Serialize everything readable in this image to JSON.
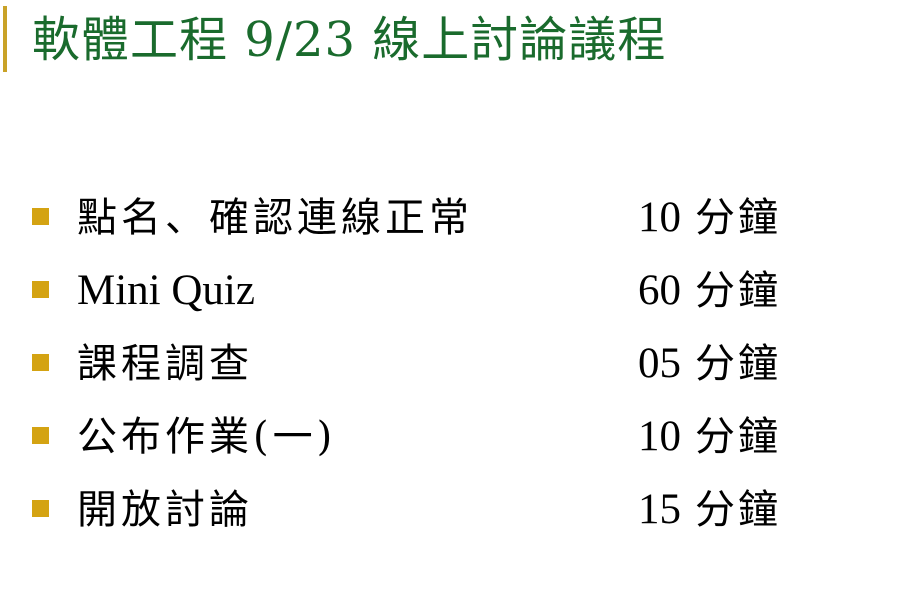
{
  "slide": {
    "title": "軟體工程 9/23 線上討論議程",
    "colors": {
      "title": "#1a6b2d",
      "accent_bar": "#c9a227",
      "bullet": "#d4a312"
    },
    "agenda": [
      {
        "topic": "點名、確認連線正常",
        "minutes": "10",
        "unit": "分鐘"
      },
      {
        "topic": "Mini Quiz",
        "minutes": "60",
        "unit": "分鐘"
      },
      {
        "topic": "課程調查",
        "minutes": "05",
        "unit": "分鐘"
      },
      {
        "topic": "公布作業(一)",
        "minutes": "10",
        "unit": "分鐘"
      },
      {
        "topic": "開放討論",
        "minutes": "15",
        "unit": "分鐘"
      }
    ]
  }
}
